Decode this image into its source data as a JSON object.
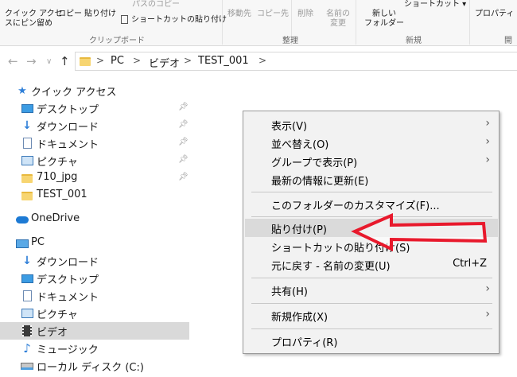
{
  "ribbon": {
    "quick_access_pin": "クイック アクセス\nにピン留め",
    "quick_access_pin_l1": "クイック アクセ",
    "quick_access_pin_l2": "スにピン留め",
    "copy": "コピー",
    "paste": "貼り付け",
    "copy_path": "パスのコピー",
    "paste_shortcut": "ショートカットの貼り付け",
    "clipboard_group": "クリップボード",
    "move_to": "移動先",
    "copy_to": "コピー先",
    "delete": "削除",
    "rename_l1": "名前の",
    "rename_l2": "変更",
    "organize_group": "整理",
    "new_folder_l1": "新しい",
    "new_folder_l2": "フォルダー",
    "shortcut": "ショートカット ▾",
    "new_group": "新規",
    "properties": "プロパティ",
    "open_partial": "開く"
  },
  "address": {
    "crumbs": [
      "PC",
      "ビデオ",
      "TEST_001"
    ],
    "sep": ">"
  },
  "tree": {
    "quick_access": "クイック アクセス",
    "desktop": "デスクトップ",
    "downloads": "ダウンロード",
    "documents": "ドキュメント",
    "pictures": "ピクチャ",
    "folder_710": "710_jpg",
    "folder_test": "TEST_001",
    "onedrive": "OneDrive",
    "pc": "PC",
    "pc_downloads": "ダウンロード",
    "pc_desktop": "デスクトップ",
    "pc_documents": "ドキュメント",
    "pc_pictures": "ピクチャ",
    "pc_videos": "ビデオ",
    "pc_music": "ミュージック",
    "local_disk": "ローカル ディスク (C:)"
  },
  "menu": {
    "view": "表示(V)",
    "sort": "並べ替え(O)",
    "group": "グループで表示(P)",
    "refresh": "最新の情報に更新(E)",
    "customize": "このフォルダーのカスタマイズ(F)...",
    "paste": "貼り付け(P)",
    "paste_shortcut": "ショートカットの貼り付け(S)",
    "undo": "元に戻す - 名前の変更(U)",
    "undo_shortcut": "Ctrl+Z",
    "share": "共有(H)",
    "new": "新規作成(X)",
    "properties": "プロパティ(R)"
  },
  "colors": {
    "accent": "#2f7fd8",
    "highlight": "#dadada",
    "annotation_arrow": "#e8192c"
  }
}
